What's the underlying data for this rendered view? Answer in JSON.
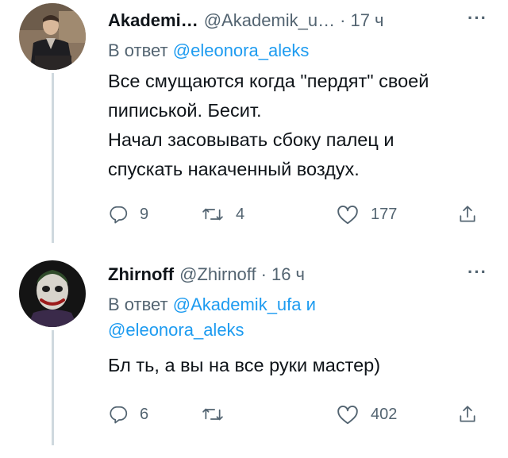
{
  "tweets": [
    {
      "display_name": "Akademi…",
      "handle": "@Akademik_u…",
      "time": "17 ч",
      "reply_prefix": "В ответ",
      "reply_mentions": [
        "@eleonora_aleks"
      ],
      "text_lines": [
        "Все смущаются  когда \"пердят\"  своей",
        "пиписькой. Бесит.",
        "Начал засовывать сбоку палец и",
        "спускать накаченный воздух."
      ],
      "replies": "9",
      "retweets": "4",
      "likes": "177",
      "icons": [
        "reply-icon",
        "retweet-icon",
        "like-icon",
        "share-icon",
        "more-icon"
      ]
    },
    {
      "display_name": "Zhirnoff",
      "handle": "@Zhirnoff",
      "time": "16 ч",
      "reply_prefix": "В ответ",
      "reply_mentions": [
        "@Akademik_ufa",
        "@eleonora_aleks"
      ],
      "reply_conjunction": "и",
      "text_lines": [
        "Бл ть, а вы на все руки мастер)"
      ],
      "replies": "6",
      "retweets": "",
      "likes": "402",
      "icons": [
        "reply-icon",
        "retweet-icon",
        "like-icon",
        "share-icon",
        "more-icon"
      ]
    }
  ],
  "colors": {
    "text": "#0f1419",
    "secondary": "#536471",
    "mention": "#1d9bf0",
    "thread_line": "#cfd9de",
    "background": "#ffffff"
  }
}
